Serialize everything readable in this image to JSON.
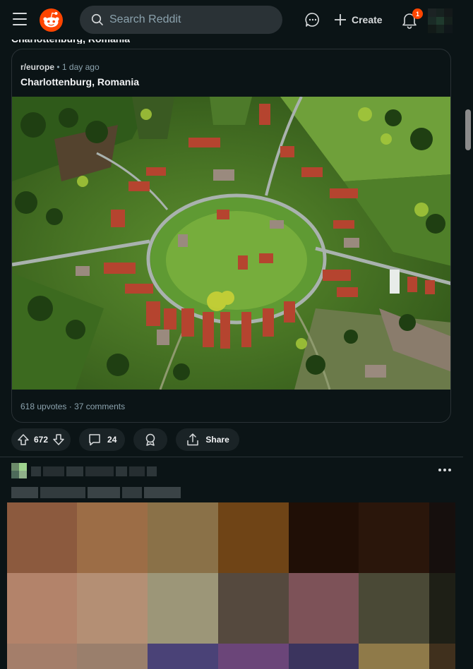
{
  "header": {
    "search_placeholder": "Search Reddit",
    "create_label": "Create",
    "notification_count": "1"
  },
  "previous_title": "Charlottenburg, Romania",
  "crosspost": {
    "subreddit": "r/europe",
    "separator": "•",
    "age": "1 day ago",
    "title": "Charlottenburg, Romania",
    "upvotes": "618 upvotes",
    "comments": "37 comments"
  },
  "actions": {
    "vote_count": "672",
    "comment_count": "24",
    "share_label": "Share"
  },
  "icons": [
    "menu-icon",
    "reddit-logo",
    "search-icon",
    "chat-icon",
    "plus-icon",
    "bell-icon",
    "upvote-icon",
    "downvote-icon",
    "comment-icon",
    "award-icon",
    "share-icon",
    "more-icon"
  ],
  "colors": {
    "background": "#0b1416",
    "accent": "#ff4500",
    "pill": "#1a2326",
    "border": "#2a3236"
  },
  "pixel_image_colors": [
    "#8c5a3e",
    "#9c6d46",
    "#8a7148",
    "#6f4416",
    "#200f06",
    "#2a160b",
    "#160f0d",
    "#b3836a",
    "#b48f74",
    "#9c9678",
    "#55493e",
    "#7d5258",
    "#4a4936",
    "#1e1f16",
    "#a47e6a",
    "#9a7f6c",
    "#4a4277",
    "#6b4579",
    "#3b345e",
    "#8f7a49",
    "#40301d"
  ]
}
